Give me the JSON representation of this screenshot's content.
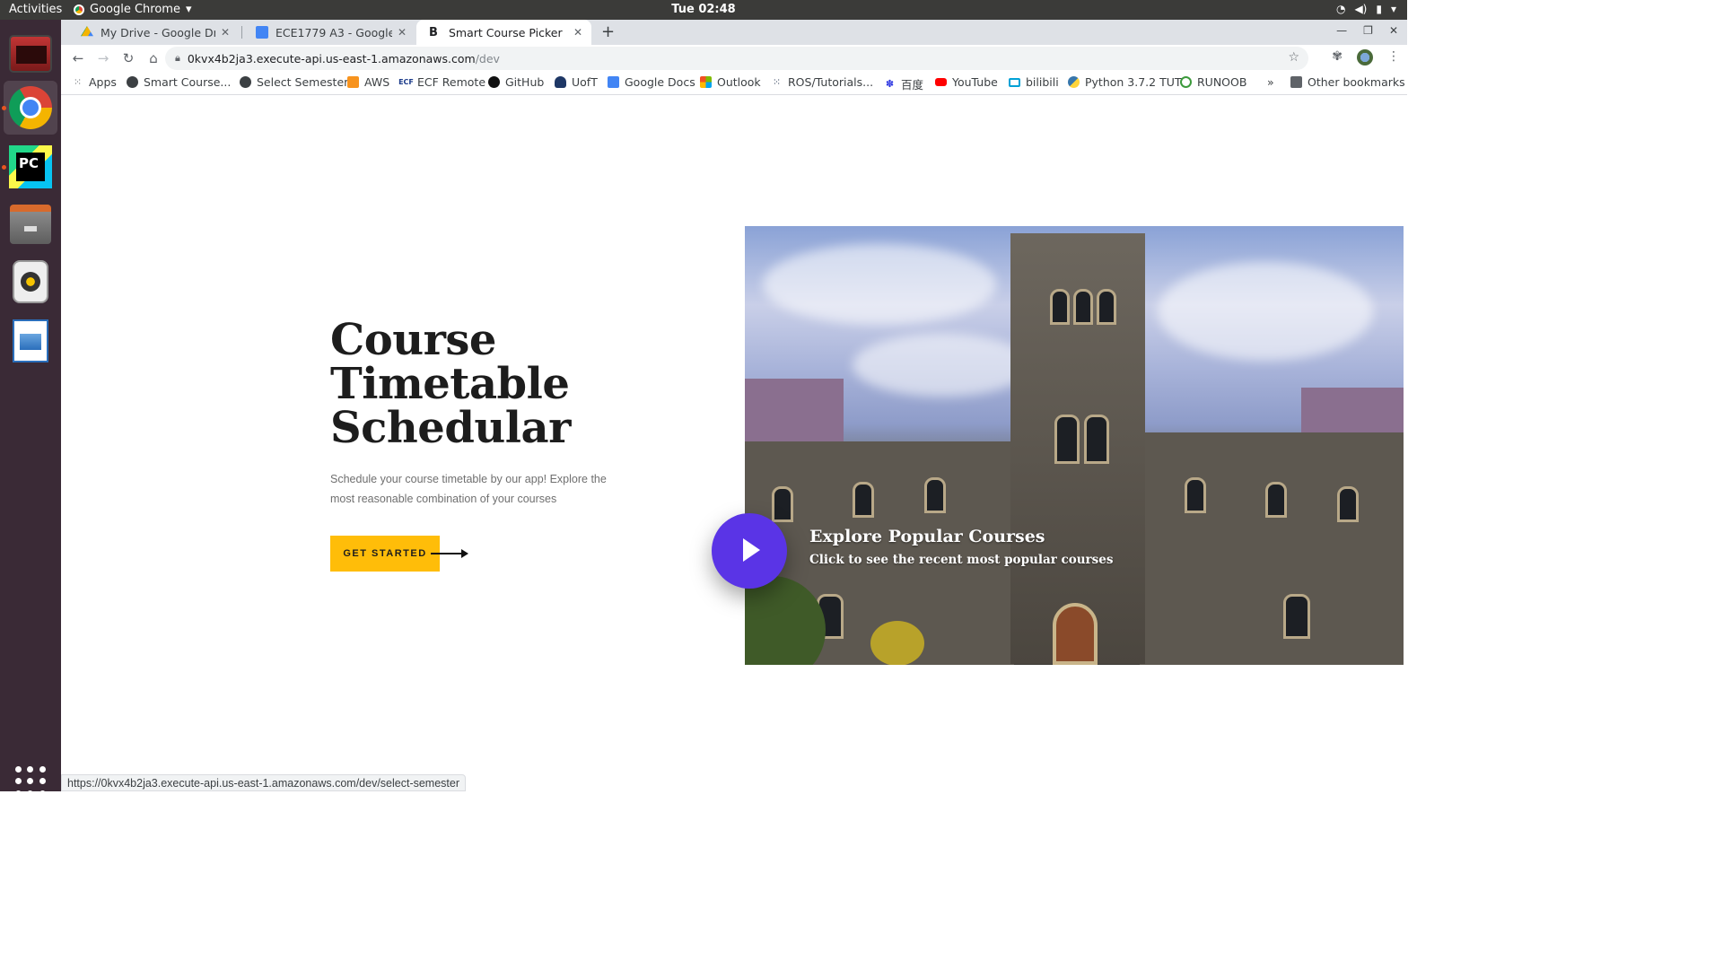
{
  "system": {
    "activities_label": "Activities",
    "app_name": "Google Chrome",
    "clock": "Tue 02:48"
  },
  "dock": {
    "items": [
      "terminal",
      "google-chrome",
      "pycharm",
      "files",
      "rhythmbox",
      "libreoffice-writer",
      "show-applications"
    ]
  },
  "browser": {
    "tabs": [
      {
        "title": "My Drive - Google Drive",
        "icon": "google-drive-icon"
      },
      {
        "title": "ECE1779 A3 - Google Docs",
        "icon": "google-docs-icon"
      },
      {
        "title": "Smart Course Picker",
        "icon": "bootstrap-b-icon"
      }
    ],
    "new_tab_label": "+",
    "url_host": "0kvx4b2ja3.execute-api.us-east-1.amazonaws.com",
    "url_path": "/dev",
    "bookmarks": [
      {
        "label": "Apps",
        "icon": "apps-grid-icon"
      },
      {
        "label": "Smart Course...",
        "icon": "globe-icon"
      },
      {
        "label": "Select Semester",
        "icon": "globe-icon"
      },
      {
        "label": "AWS",
        "icon": "aws-icon"
      },
      {
        "label": "ECF Remote",
        "icon": "ecf-icon"
      },
      {
        "label": "GitHub",
        "icon": "github-icon"
      },
      {
        "label": "UofT",
        "icon": "uoft-icon"
      },
      {
        "label": "Google Docs",
        "icon": "google-docs-icon"
      },
      {
        "label": "Outlook",
        "icon": "microsoft-icon"
      },
      {
        "label": "ROS/Tutorials...",
        "icon": "ros-icon"
      },
      {
        "label": "百度",
        "icon": "baidu-icon"
      },
      {
        "label": "YouTube",
        "icon": "youtube-icon"
      },
      {
        "label": "bilibili",
        "icon": "bilibili-icon"
      },
      {
        "label": "Python 3.7.2 TUT",
        "icon": "python-icon"
      },
      {
        "label": "RUNOOB",
        "icon": "runoob-icon"
      }
    ],
    "more_bookmarks": "»",
    "other_bookmarks": "Other bookmarks",
    "status_url": "https://0kvx4b2ja3.execute-api.us-east-1.amazonaws.com/dev/select-semester"
  },
  "page": {
    "hero_title_line1": "Course",
    "hero_title_line2": "Timetable",
    "hero_title_line3": "Schedular",
    "hero_text": "Schedule your course timetable by our app! Explore the most reasonable combination of your courses",
    "cta_label": "GET STARTED",
    "overlay_title": "Explore Popular Courses",
    "overlay_subtitle": "Click to see the recent most popular courses"
  },
  "colors": {
    "cta": "#ffbd09",
    "play_button": "#5a34e6",
    "heading": "#1d1d1d"
  }
}
